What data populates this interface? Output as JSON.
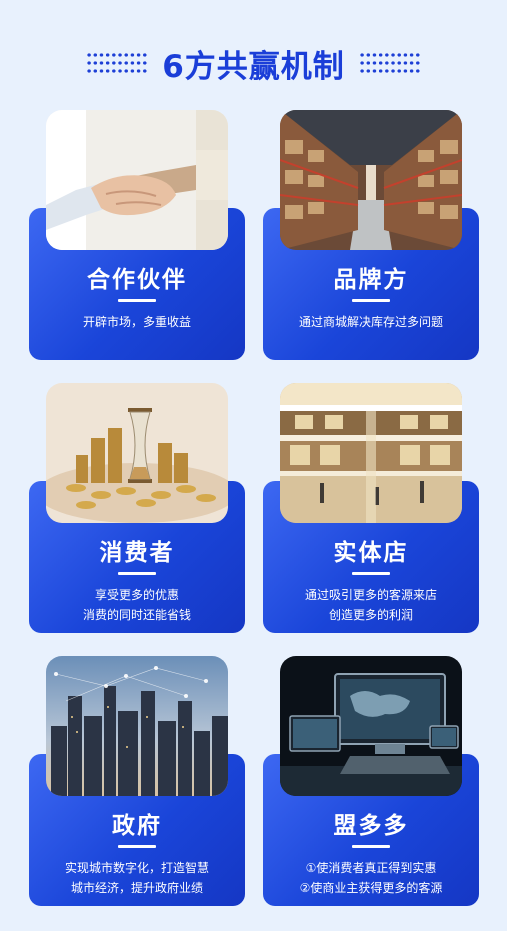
{
  "header": {
    "title": "6方共赢机制"
  },
  "cards": [
    {
      "name": "合作伙伴",
      "lines": [
        "开辟市场，多重收益"
      ],
      "photo_icon": "handshake-photo"
    },
    {
      "name": "品牌方",
      "lines": [
        "通过商城解决库存过多问题"
      ],
      "photo_icon": "warehouse-photo"
    },
    {
      "name": "消费者",
      "lines": [
        "享受更多的优惠",
        "消费的同时还能省钱"
      ],
      "photo_icon": "coins-hourglass-photo"
    },
    {
      "name": "实体店",
      "lines": [
        "通过吸引更多的客源来店",
        "创造更多的利润"
      ],
      "photo_icon": "shopping-mall-photo"
    },
    {
      "name": "政府",
      "lines": [
        "实现城市数字化，打造智慧",
        "城市经济，提升政府业绩"
      ],
      "photo_icon": "city-skyline-photo"
    },
    {
      "name": "盟多多",
      "lines": [
        "①使消费者真正得到实惠",
        "②使商业主获得更多的客源"
      ],
      "photo_icon": "computer-devices-photo"
    }
  ],
  "colors": {
    "accent": "#1a3ed8",
    "panel": "#1a45d9",
    "background": "#e8f1fd"
  }
}
